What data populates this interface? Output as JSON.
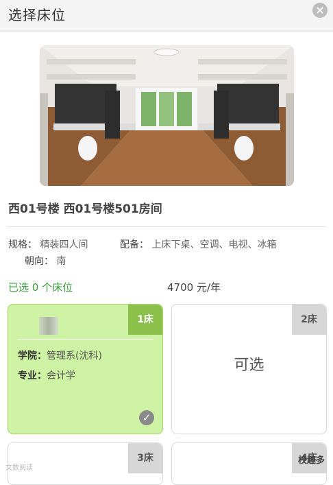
{
  "header": {
    "title": "选择床位",
    "close_symbol": "×"
  },
  "room": {
    "building_title": "西01号楼 西01号楼501房间",
    "spec_label": "规格：",
    "spec_value": "精装四人间",
    "equip_label": "配备：",
    "equip_value": "上床下桌、空调、电视、冰箱",
    "orient_label": "朝向：",
    "orient_value": "南"
  },
  "selection": {
    "selected_text": "已选 0 个床位",
    "price_text": "4700 元/年"
  },
  "beds": [
    {
      "no": "1床",
      "selected": true,
      "college_label": "学院：",
      "college_value": "管理系(沈科)",
      "major_label": "专业：",
      "major_value": "会计学"
    },
    {
      "no": "2床",
      "selected": false,
      "status_text": "可选"
    },
    {
      "no": "3床",
      "selected": false
    },
    {
      "no": "4床",
      "selected": false
    }
  ],
  "watermark": {
    "left": "文数阅读",
    "right": "校趣多"
  }
}
